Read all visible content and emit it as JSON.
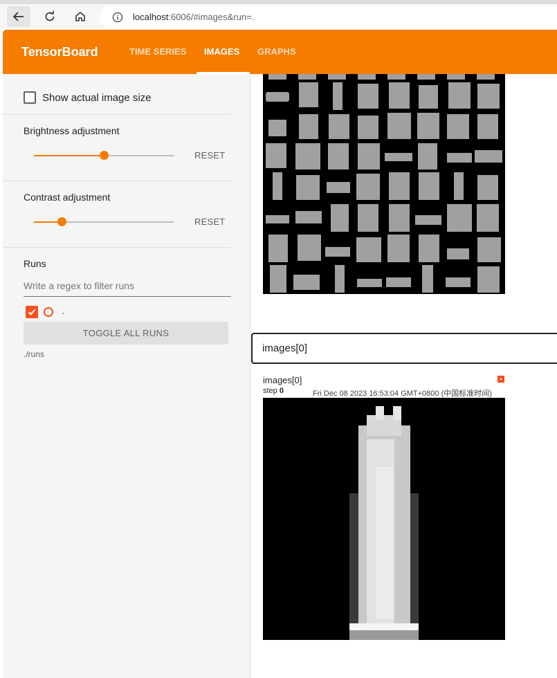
{
  "browser": {
    "url_host": "localhost",
    "url_rest": ":6006/#images&run=."
  },
  "header": {
    "title": "TensorBoard",
    "tabs": [
      {
        "label": "TIME SERIES",
        "active": false
      },
      {
        "label": "IMAGES",
        "active": true
      },
      {
        "label": "GRAPHS",
        "active": false
      }
    ],
    "color": "#f57c00"
  },
  "sidebar": {
    "show_actual_size": {
      "label": "Show actual image size",
      "checked": false
    },
    "brightness": {
      "label": "Brightness adjustment",
      "reset_label": "RESET",
      "value": 0.5
    },
    "contrast": {
      "label": "Contrast adjustment",
      "reset_label": "RESET",
      "value": 0.2
    },
    "runs": {
      "label": "Runs",
      "filter_placeholder": "Write a regex to filter runs",
      "items": [
        {
          "name": ".",
          "checked": true,
          "color": "#f4511e"
        }
      ],
      "toggle_label": "TOGGLE ALL RUNS",
      "path": "./runs"
    }
  },
  "main": {
    "tag_filter_value": "images[0]",
    "card": {
      "title": "images[0]",
      "step_label": "step",
      "step_value": "0",
      "timestamp": "Fri Dec 08 2023 16:53:04 GMT+0800 (中国标准时间)"
    }
  }
}
